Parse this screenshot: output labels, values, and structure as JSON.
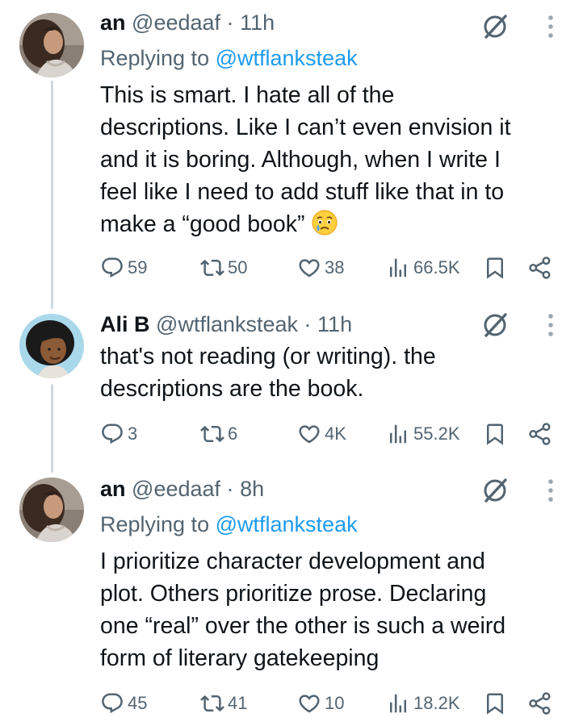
{
  "tweets": [
    {
      "name": "an",
      "handle": "@eedaaf",
      "separator": "·",
      "time": "11h",
      "replying_prefix": "Replying to",
      "replying_handle": "@wtflanksteak",
      "lines": [
        "This is smart. I hate all of the",
        "descriptions. Like I can’t even envision it",
        "and it is boring. Although, when I write I",
        "feel like I need to add stuff like that in to",
        "make a “good book”"
      ],
      "emoji": "face-holding-back-tears",
      "replies": "59",
      "reposts": "50",
      "likes": "38",
      "views": "66.5K"
    },
    {
      "name": "Ali B",
      "handle": "@wtflanksteak",
      "separator": "·",
      "time": "11h",
      "lines": [
        "that's not reading (or writing). the",
        "descriptions are the book."
      ],
      "replies": "3",
      "reposts": "6",
      "likes": "4K",
      "views": "55.2K"
    },
    {
      "name": "an",
      "handle": "@eedaaf",
      "separator": "·",
      "time": "8h",
      "replying_prefix": "Replying to",
      "replying_handle": "@wtflanksteak",
      "lines": [
        "I prioritize character development and",
        "plot. Others prioritize prose. Declaring",
        "one “real” over the other is such a weird",
        "form of literary gatekeeping"
      ],
      "replies": "45",
      "reposts": "41",
      "likes": "10",
      "views": "18.2K"
    }
  ],
  "colors": {
    "text": "#0f1419",
    "secondary": "#536471",
    "link": "#1d9bf0",
    "thread_line": "#cfd9de"
  },
  "icons": [
    "reply-icon",
    "repost-icon",
    "like-icon",
    "views-icon",
    "bookmark-icon",
    "share-icon",
    "grok-icon",
    "more-icon"
  ]
}
